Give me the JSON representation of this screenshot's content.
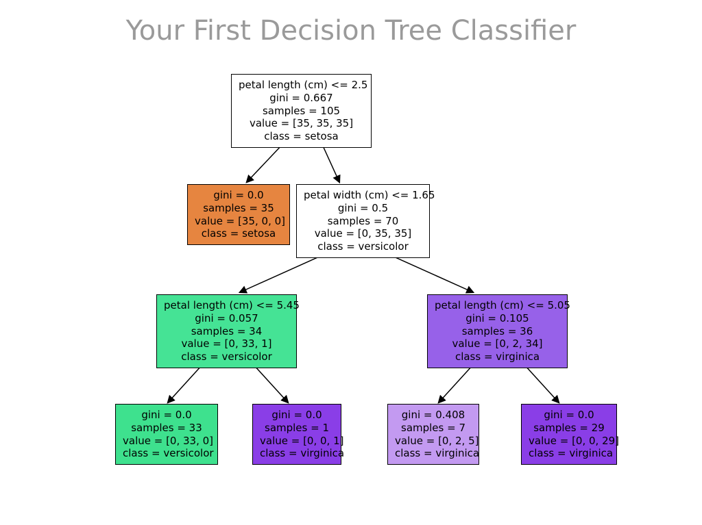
{
  "title": "Your First Decision Tree Classifier",
  "nodes": {
    "root": {
      "condition": "petal length (cm) <= 2.5",
      "gini": "gini = 0.667",
      "samples": "samples = 105",
      "value": "value = [35, 35, 35]",
      "class": "class = setosa",
      "fill": "#ffffff"
    },
    "n1_left": {
      "gini": "gini = 0.0",
      "samples": "samples = 35",
      "value": "value = [35, 0, 0]",
      "class": "class = setosa",
      "fill": "#e68540"
    },
    "n1_right": {
      "condition": "petal width (cm) <= 1.65",
      "gini": "gini = 0.5",
      "samples": "samples = 70",
      "value": "value = [0, 35, 35]",
      "class": "class = versicolor",
      "fill": "#ffffff"
    },
    "n2_left": {
      "condition": "petal length (cm) <= 5.45",
      "gini": "gini = 0.057",
      "samples": "samples = 34",
      "value": "value = [0, 33, 1]",
      "class": "class = versicolor",
      "fill": "#45e395"
    },
    "n2_right": {
      "condition": "petal length (cm) <= 5.05",
      "gini": "gini = 0.105",
      "samples": "samples = 36",
      "value": "value = [0, 2, 34]",
      "class": "class = virginica",
      "fill": "#9761e9"
    },
    "n3_a": {
      "gini": "gini = 0.0",
      "samples": "samples = 33",
      "value": "value = [0, 33, 0]",
      "class": "class = versicolor",
      "fill": "#3ee18e"
    },
    "n3_b": {
      "gini": "gini = 0.0",
      "samples": "samples = 1",
      "value": "value = [0, 0, 1]",
      "class": "class = virginica",
      "fill": "#8a3ee7"
    },
    "n3_c": {
      "gini": "gini = 0.408",
      "samples": "samples = 7",
      "value": "value = [0, 2, 5]",
      "class": "class = virginica",
      "fill": "#c39af1"
    },
    "n3_d": {
      "gini": "gini = 0.0",
      "samples": "samples = 29",
      "value": "value = [0, 0, 29]",
      "class": "class = virginica",
      "fill": "#8a3ee7"
    }
  },
  "chart_data": {
    "type": "decision_tree",
    "title": "Your First Decision Tree Classifier",
    "feature_names": [
      "petal length (cm)",
      "petal width (cm)"
    ],
    "class_names": [
      "setosa",
      "versicolor",
      "virginica"
    ],
    "tree": {
      "split": "petal length (cm) <= 2.5",
      "gini": 0.667,
      "samples": 105,
      "value": [
        35,
        35,
        35
      ],
      "class": "setosa",
      "left": {
        "gini": 0.0,
        "samples": 35,
        "value": [
          35,
          0,
          0
        ],
        "class": "setosa"
      },
      "right": {
        "split": "petal width (cm) <= 1.65",
        "gini": 0.5,
        "samples": 70,
        "value": [
          0,
          35,
          35
        ],
        "class": "versicolor",
        "left": {
          "split": "petal length (cm) <= 5.45",
          "gini": 0.057,
          "samples": 34,
          "value": [
            0,
            33,
            1
          ],
          "class": "versicolor",
          "left": {
            "gini": 0.0,
            "samples": 33,
            "value": [
              0,
              33,
              0
            ],
            "class": "versicolor"
          },
          "right": {
            "gini": 0.0,
            "samples": 1,
            "value": [
              0,
              0,
              1
            ],
            "class": "virginica"
          }
        },
        "right": {
          "split": "petal length (cm) <= 5.05",
          "gini": 0.105,
          "samples": 36,
          "value": [
            0,
            2,
            34
          ],
          "class": "virginica",
          "left": {
            "gini": 0.408,
            "samples": 7,
            "value": [
              0,
              2,
              5
            ],
            "class": "virginica"
          },
          "right": {
            "gini": 0.0,
            "samples": 29,
            "value": [
              0,
              0,
              29
            ],
            "class": "virginica"
          }
        }
      }
    }
  }
}
